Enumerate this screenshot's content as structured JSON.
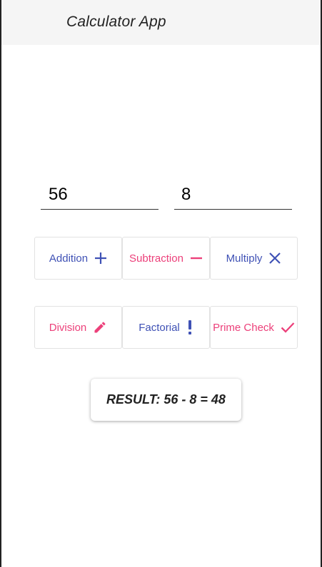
{
  "app": {
    "title": "Calculator App"
  },
  "inputs": {
    "first_value": "56",
    "second_value": "8"
  },
  "operations": [
    {
      "label": "Addition",
      "icon": "plus-icon",
      "color": "#3f51b5"
    },
    {
      "label": "Subtraction",
      "icon": "minus-icon",
      "color": "#ec407a"
    },
    {
      "label": "Multiply",
      "icon": "close-icon",
      "color": "#3f51b5"
    },
    {
      "label": "Division",
      "icon": "pencil-icon",
      "color": "#ec407a"
    },
    {
      "label": "Factorial",
      "icon": "exclamation-icon",
      "color": "#3f51b5"
    },
    {
      "label": "Prime Check",
      "icon": "check-icon",
      "color": "#ec407a"
    }
  ],
  "result": {
    "text": "RESULT: 56 - 8 = 48"
  },
  "colors": {
    "primary": "#3f51b5",
    "accent": "#ec407a",
    "header_bg": "#f5f5f5"
  }
}
